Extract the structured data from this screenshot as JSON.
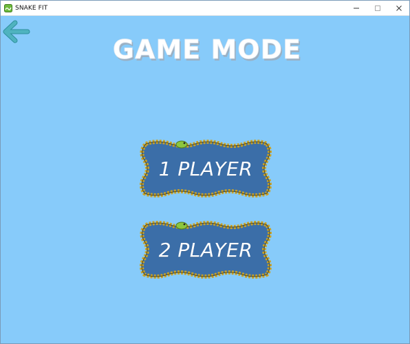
{
  "window": {
    "title": "SNAKE FIT",
    "controls": [
      "minimize-icon",
      "maximize-icon",
      "close-icon"
    ]
  },
  "screen": {
    "heading": "GAME MODE",
    "back_icon": "arrow-left-icon"
  },
  "modes": [
    {
      "label": "1 PLAYER"
    },
    {
      "label": "2 PLAYER"
    }
  ],
  "colors": {
    "background": "#87cbfa",
    "button_fill": "#3b6ea8",
    "snake_border": "#c9a227",
    "snake_head": "#8dc63f",
    "back_arrow": "#4fb3bf",
    "heading_fill": "#ffffff"
  }
}
